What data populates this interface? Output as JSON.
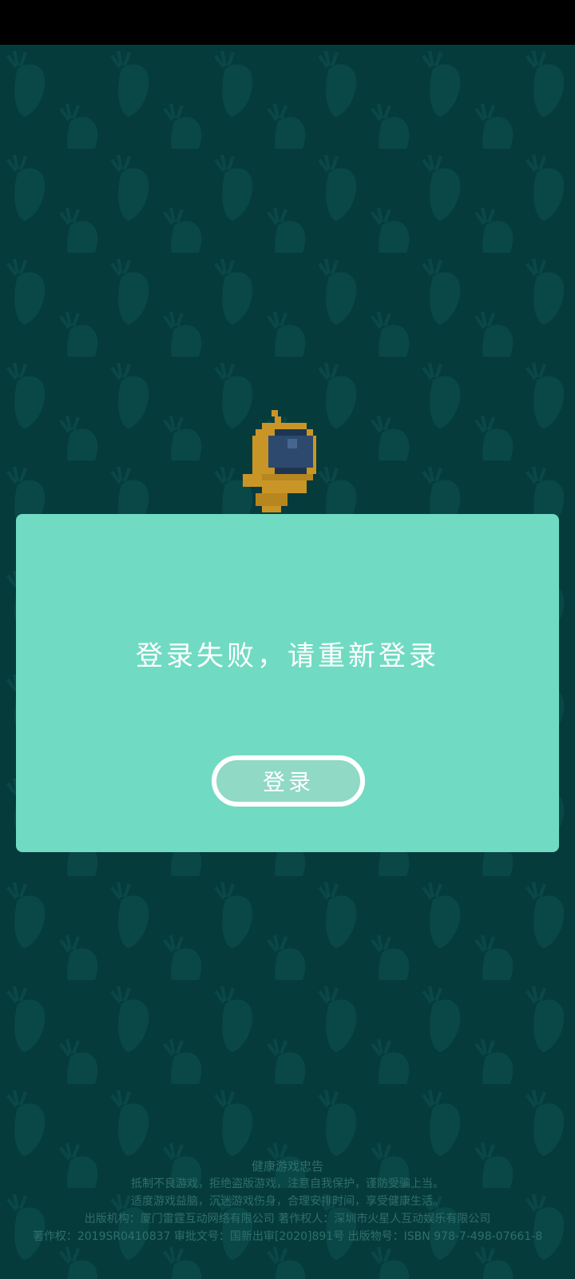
{
  "colors": {
    "status_bar": "#000000",
    "background": "#063b3c",
    "pattern": "#0a4a4a",
    "dialog": "#70dbc2",
    "button_fill": "#8fd9c5",
    "button_border": "#ffffff",
    "text_white": "#ffffff",
    "footer_text": "#2f6f69",
    "mascot_body": "#c99527",
    "mascot_visor": "#2d4a6e"
  },
  "mascot": {
    "icon": "pixel-astronaut-icon"
  },
  "dialog": {
    "message": "登录失败，请重新登录",
    "button_label": "登录"
  },
  "footer": {
    "title": "健康游戏忠告",
    "line1": "抵制不良游戏，拒绝盗版游戏，注意自我保护，谨防受骗上当。",
    "line2": "适度游戏益脑，沉迷游戏伤身，合理安排时间，享受健康生活。",
    "line3": "出版机构：厦门雷霆互动网络有限公司  著作权人：深圳市火星人互动娱乐有限公司",
    "line4": "著作权：2019SR0410837  审批文号：国新出审[2020]891号  出版物号：ISBN 978-7-498-07661-8"
  }
}
